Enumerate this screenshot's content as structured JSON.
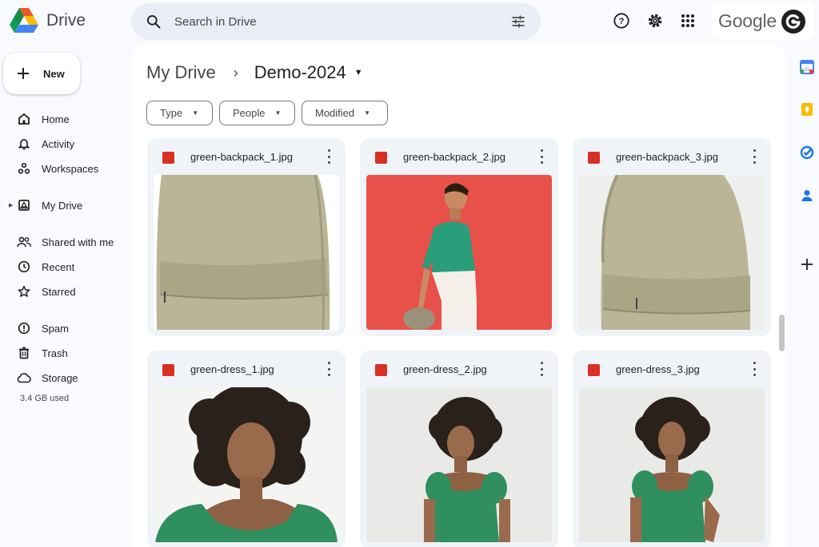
{
  "app": {
    "name": "Drive"
  },
  "search": {
    "placeholder": "Search in Drive"
  },
  "account": {
    "name": "Google"
  },
  "sidebar": {
    "new_label": "New",
    "items": [
      {
        "label": "Home",
        "icon": "home-icon"
      },
      {
        "label": "Activity",
        "icon": "bell-icon"
      },
      {
        "label": "Workspaces",
        "icon": "workspaces-icon"
      },
      {
        "label": "My Drive",
        "icon": "my-drive-icon"
      },
      {
        "label": "Shared with me",
        "icon": "shared-icon"
      },
      {
        "label": "Recent",
        "icon": "clock-icon"
      },
      {
        "label": "Starred",
        "icon": "star-icon"
      },
      {
        "label": "Spam",
        "icon": "spam-icon"
      },
      {
        "label": "Trash",
        "icon": "trash-icon"
      },
      {
        "label": "Storage",
        "icon": "cloud-icon"
      }
    ],
    "storage_used": "3.4 GB used"
  },
  "breadcrumb": {
    "root": "My Drive",
    "current": "Demo-2024"
  },
  "filters": [
    {
      "label": "Type"
    },
    {
      "label": "People"
    },
    {
      "label": "Modified"
    }
  ],
  "files": [
    {
      "name": "green-backpack_1.jpg",
      "thumb": "backpack"
    },
    {
      "name": "green-backpack_2.jpg",
      "thumb": "man-red"
    },
    {
      "name": "green-backpack_3.jpg",
      "thumb": "backpack"
    },
    {
      "name": "green-dress_1.jpg",
      "thumb": "woman-closeup"
    },
    {
      "name": "green-dress_2.jpg",
      "thumb": "woman-down"
    },
    {
      "name": "green-dress_3.jpg",
      "thumb": "woman-forward"
    }
  ],
  "colors": {
    "accent": "#0b57d0",
    "panel": "#f0f4f9",
    "image_icon": "#d93025",
    "backpack": "#b9b596",
    "red_backdrop": "#e8504a",
    "shirt_green": "#2a9d7a",
    "dress_green": "#2f8f5e"
  }
}
